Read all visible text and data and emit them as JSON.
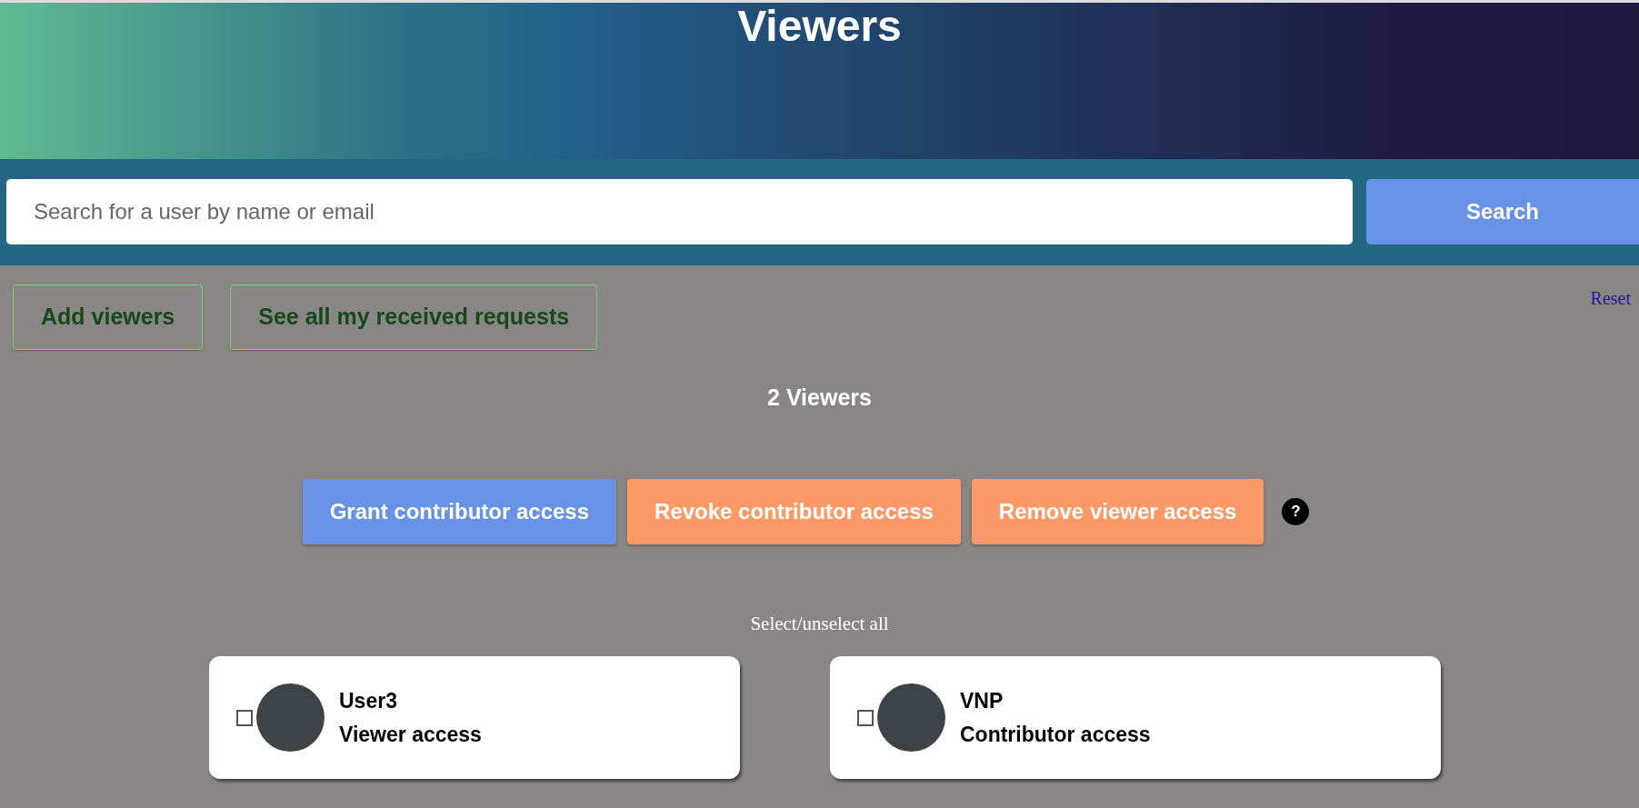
{
  "header": {
    "title": "Viewers"
  },
  "search": {
    "placeholder": "Search for a user by name or email",
    "button": "Search"
  },
  "actions": [
    "Add viewers",
    "See all my received requests"
  ],
  "reset_link": "Reset",
  "count": "2 Viewers",
  "bulk_buttons": [
    {
      "label": "Grant contributor access",
      "kind": "grant"
    },
    {
      "label": "Revoke contributor access",
      "kind": "revoke"
    },
    {
      "label": "Remove viewer access",
      "kind": "revoke"
    }
  ],
  "help": "?",
  "select_all": "Select/unselect all",
  "users": [
    {
      "name": "User3",
      "access": "Viewer access",
      "checked": false
    },
    {
      "name": "VNP",
      "access": "Contributor access",
      "checked": false
    }
  ]
}
